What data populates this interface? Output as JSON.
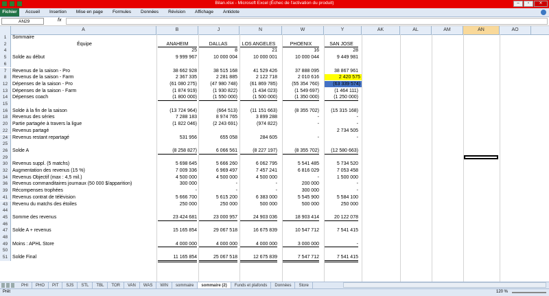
{
  "window": {
    "title": "Bilan.xlsx - Microsoft Excel (Échec de l'activation du produit)"
  },
  "ribbon": {
    "file": "Fichier",
    "tabs": [
      "Accueil",
      "Insertion",
      "Mise en page",
      "Formules",
      "Données",
      "Révision",
      "Affichage",
      "Antidote"
    ]
  },
  "formula_bar": {
    "name_box": "AN29",
    "fx": "fx",
    "value": ""
  },
  "columns": {
    "a": "A",
    "b": "B",
    "j": "J",
    "n": "N",
    "w": "W",
    "y": "Y",
    "ak": "AK",
    "al": "AL",
    "am": "AM",
    "an": "AN",
    "ao": "AO"
  },
  "rows": [
    {
      "n": "1",
      "a": "Sommaire"
    },
    {
      "n": "2",
      "a": "Équipe",
      "b": "ANAHEIM",
      "j": "DALLAS",
      "n2": "LOS ANGELES",
      "w": "PHOENIX",
      "y": "SAN JOSE"
    },
    {
      "n": "4",
      "a": "",
      "b": "25",
      "j": "8",
      "n2": "21",
      "w": "16",
      "y": "28"
    },
    {
      "n": "5",
      "a": "Solde au début",
      "b": "9 999 967",
      "j": "10 000 004",
      "n2": "10 000 001",
      "w": "10 000 044",
      "y": "9 449 981"
    },
    {
      "n": "6",
      "a": ""
    },
    {
      "n": "7",
      "a": "Revenus de la saison - Pro",
      "b": "38 662 928",
      "j": "38 515 168",
      "n2": "41 529 426",
      "w": "37 888 095",
      "y": "38 867 961"
    },
    {
      "n": "8",
      "a": "Revenus de la saison - Farm",
      "b": "2 367 335",
      "j": "2 281 885",
      "n2": "2 122 718",
      "w": "2 010 616",
      "y": "2 420 575"
    },
    {
      "n": "12",
      "a": "Dépenses de la saison - Pro",
      "b": "(61 080 275)",
      "j": "(47 980 748)",
      "n2": "(61 869 785)",
      "w": "(55 354 760)",
      "y": "(63 339 574)"
    },
    {
      "n": "13",
      "a": "Dépenses de la saison - Farm",
      "b": "(1 874 919)",
      "j": "(1 930 822)",
      "n2": "(1 434 023)",
      "w": "(1 549 697)",
      "y": "(1 464 111)"
    },
    {
      "n": "14",
      "a": "Dépenses coach",
      "b": "(1 800 000)",
      "j": "(1 550 000)",
      "n2": "(1 500 000)",
      "w": "(1 350 000)",
      "y": "(1 250 000)"
    },
    {
      "n": "15",
      "a": ""
    },
    {
      "n": "16",
      "a": "Solde à la fin de la saison",
      "b": "(13 724 964)",
      "j": "(664 513)",
      "n2": "(11 151 663)",
      "w": "(8 355 702)",
      "y": "(15 315 168)"
    },
    {
      "n": "18",
      "a": "Revenus des séries",
      "b": "7 288 183",
      "j": "8 974 765",
      "n2": "3 899 288",
      "w": "-",
      "y": "-"
    },
    {
      "n": "20",
      "a": "Partie partagée à travers la ligue",
      "b": "(1 822 046)",
      "j": "(2 243 691)",
      "n2": "(974 822)",
      "w": "-",
      "y": "-"
    },
    {
      "n": "22",
      "a": "Revenus partagé",
      "b": "",
      "j": "",
      "n2": "",
      "w": "",
      "y": "2 734 505"
    },
    {
      "n": "24",
      "a": "Revenus restant repartagé",
      "b": "531 956",
      "j": "655 058",
      "n2": "284 605",
      "w": "-",
      "y": "-"
    },
    {
      "n": "25",
      "a": ""
    },
    {
      "n": "26",
      "a": "Solde A",
      "b": "(8 258 827)",
      "j": "6 066 561",
      "n2": "(8 227 197)",
      "w": "(8 355 702)",
      "y": "(12 580 663)"
    },
    {
      "n": "29",
      "a": ""
    },
    {
      "n": "30",
      "a": "Revenus suppl. (5 matchs)",
      "b": "5 698 645",
      "j": "5 666 260",
      "n2": "6 062 795",
      "w": "5 541 485",
      "y": "5 734 520"
    },
    {
      "n": "32",
      "a": "Augmentation des revenus (15 %)",
      "b": "7 009 336",
      "j": "6 969 497",
      "n2": "7 457 241",
      "w": "6 816 029",
      "y": "7 053 458"
    },
    {
      "n": "34",
      "a": "Revenus Objectif (max : 4,5 mil.)",
      "b": "4 500 000",
      "j": "4 500 000",
      "n2": "4 500 000",
      "w": "-",
      "y": "1 500 000"
    },
    {
      "n": "36",
      "a": "Revenus commanditaires journaux (50 000 $/apparition)",
      "b": "300 000",
      "j": "-",
      "n2": "-",
      "w": "200 000",
      "y": "-"
    },
    {
      "n": "39",
      "a": "Récompenses trophées",
      "b": "-",
      "j": "-",
      "n2": "-",
      "w": "300 000",
      "y": "-"
    },
    {
      "n": "41",
      "a": "Revenus contrat de télévision",
      "b": "5 666 700",
      "j": "5 615 200",
      "n2": "6 383 000",
      "w": "5 545 900",
      "y": "5 584 100"
    },
    {
      "n": "43",
      "a": "Revenu du matchs des étoiles",
      "b": "250 000",
      "j": "250 000",
      "n2": "500 000",
      "w": "500 000",
      "y": "250 000"
    },
    {
      "n": "44",
      "a": ""
    },
    {
      "n": "45",
      "a": "Somme des revenus",
      "b": "23 424 681",
      "j": "23 000 957",
      "n2": "24 903 036",
      "w": "18 903 414",
      "y": "20 122 078"
    },
    {
      "n": "46",
      "a": ""
    },
    {
      "n": "47",
      "a": "Solde A + revenus",
      "b": "15 165 854",
      "j": "29 067 518",
      "n2": "16 675 839",
      "w": "10 547 712",
      "y": "7 541 415"
    },
    {
      "n": "48",
      "a": ""
    },
    {
      "n": "49",
      "a": "Moins : APHL Store",
      "b": "4 000 000",
      "j": "4 000 000",
      "n2": "4 000 000",
      "w": "3 000 000",
      "y": "-"
    },
    {
      "n": "50",
      "a": ""
    },
    {
      "n": "51",
      "a": "Solde Final",
      "b": "11 165 854",
      "j": "25 067 518",
      "n2": "12 675 839",
      "w": "7 547 712",
      "y": "7 541 415"
    }
  ],
  "colors": {
    "y8_fill": "#ffff00",
    "y12_fill": "#4472c4",
    "selected_col": "#f9d99a"
  },
  "sheet_tabs": [
    "PHI",
    "PHO",
    "PIT",
    "SJS",
    "STL",
    "TBL",
    "TOR",
    "VAN",
    "WAS",
    "WIN",
    "sommaire",
    "sommaire (2)",
    "Funds et plafonds",
    "Données",
    "Store"
  ],
  "active_sheet": "sommaire (2)",
  "status": {
    "ready": "Prêt",
    "zoom": "120 %"
  }
}
